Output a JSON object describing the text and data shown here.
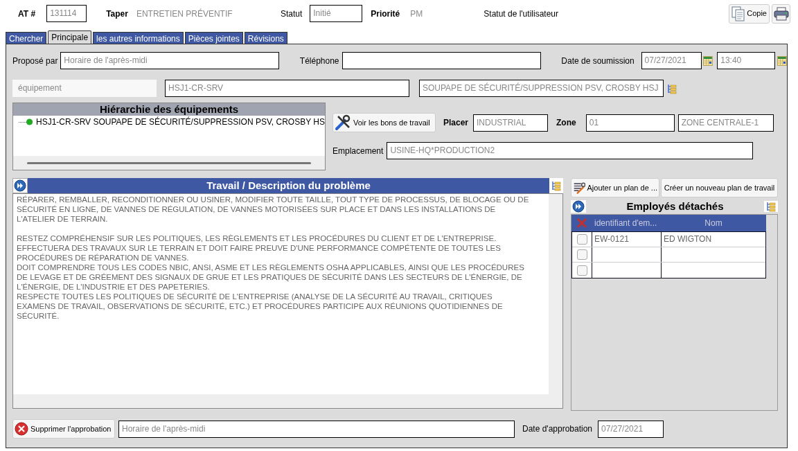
{
  "header": {
    "at_label": "AT #",
    "at_value": "131114",
    "type_label": "Taper",
    "type_value": "ENTRETIEN PRÉVENTIF",
    "status_label": "Statut",
    "status_value": "Initié",
    "priority_label": "Priorité",
    "priority_value": "PM",
    "user_status_label": "Statut de l'utilisateur",
    "copy_button": "Copie"
  },
  "tabs": [
    {
      "label": "Chercher",
      "selected": false
    },
    {
      "label": "Principale",
      "selected": true
    },
    {
      "label": "les autres informations",
      "selected": false
    },
    {
      "label": "Pièces jointes",
      "selected": false
    },
    {
      "label": "Révisions",
      "selected": false
    }
  ],
  "form": {
    "proposed_by_label": "Proposé par",
    "proposed_by_value": "Horaire de l'après-midi",
    "phone_label": "Téléphone",
    "submit_date_label": "Date de soumission",
    "submit_date": "07/27/2021",
    "submit_time": "13:40",
    "equipment_label": "équipement",
    "equipment_code": "HSJ1-CR-SRV",
    "equipment_desc": "SOUPAPE DE SÉCURITÉ/SUPPRESSION PSV, CROSBY HSJ",
    "view_orders_button": "Voir les bons de travail",
    "place_label": "Placer",
    "place_value": "INDUSTRIAL",
    "zone_label": "Zone",
    "zone_code": "01",
    "zone_name": "ZONE CENTRALE-1",
    "location_label": "Emplacement",
    "location_value": "USINE-HQ*PRODUCTION2"
  },
  "hierarchy": {
    "title": "Hiérarchie des équipements",
    "items": [
      {
        "label": "HSJ1-CR-SRV SOUPAPE DE SÉCURITÉ/SUPPRESSION PSV, CROSBY HS",
        "color": "#22aa22"
      }
    ]
  },
  "description": {
    "title": "Travail / Description du problème",
    "blocks": [
      [
        "RÉPARER, REMBALLER, RECONDITIONNER OU USINER, MODIFIER TOUTE TAILLE, TOUT TYPE DE PROCESSUS, DE BLOCAGE OU DE SÉCURITÉ EN LIGNE, DE VANNES DE RÉGULATION, DE VANNES MOTORISÉES SUR PLACE ET DANS LES INSTALLATIONS DE L'ATELIER DE TERRAIN."
      ],
      [
        "RESTEZ COMPRÉHENSIF SUR LES POLITIQUES, LES RÈGLEMENTS ET LES PROCÉDURES DU CLIENT ET DE L'ENTREPRISE.",
        "EFFECTUERA DES TRAVAUX SUR LE TERRAIN ET DOIT FAIRE PREUVE D'UNE PERFORMANCE COMPÉTENTE DE TOUTES LES PROCÉDURES DE RÉPARATION DE VANNES.",
        "DOIT COMPRENDRE TOUS LES CODES NBIC, ANSI, ASME ET LES RÈGLEMENTS OSHA APPLICABLES, AINSI QUE LES PROCÉDURES DE LEVAGE ET DE GRÉEMENT DES SIGNAUX DE GRUE ET LES PRATIQUES DE SÉCURITÉ DANS LES SECTEURS DE L'ÉNERGIE, DE L'ÉNERGIE, DE L'INDUSTRIE ET DES PAPETERIES.",
        "RESPECTE TOUTES LES POLITIQUES DE SÉCURITÉ DE L'ENTREPRISE (ANALYSE DE LA SÉCURITÉ AU TRAVAIL, CRITIQUES EXAMENS DE TRAVAIL, OBSERVATIONS DE SÉCURITÉ, ETC.) ET PROCÉDURES PARTICIPE AUX RÉUNIONS QUOTIDIENNES DE SÉCURITÉ."
      ]
    ]
  },
  "employees": {
    "add_plan_button": "Ajouter un plan de ...",
    "create_plan_button": "Créer un nouveau plan de travail",
    "title": "Employés détachés",
    "columns": [
      "identifiant d'em...",
      "Nom"
    ],
    "rows": [
      {
        "checked": false,
        "id": "EW-0121",
        "name": "ED WIGTON"
      },
      {
        "checked": false
      },
      {
        "checked": false
      }
    ]
  },
  "approval": {
    "delete_button": "Supprimer l'approbation",
    "value": "Horaire de l'après-midi",
    "date_label": "Date d'approbation",
    "date": "07/27/2021"
  }
}
